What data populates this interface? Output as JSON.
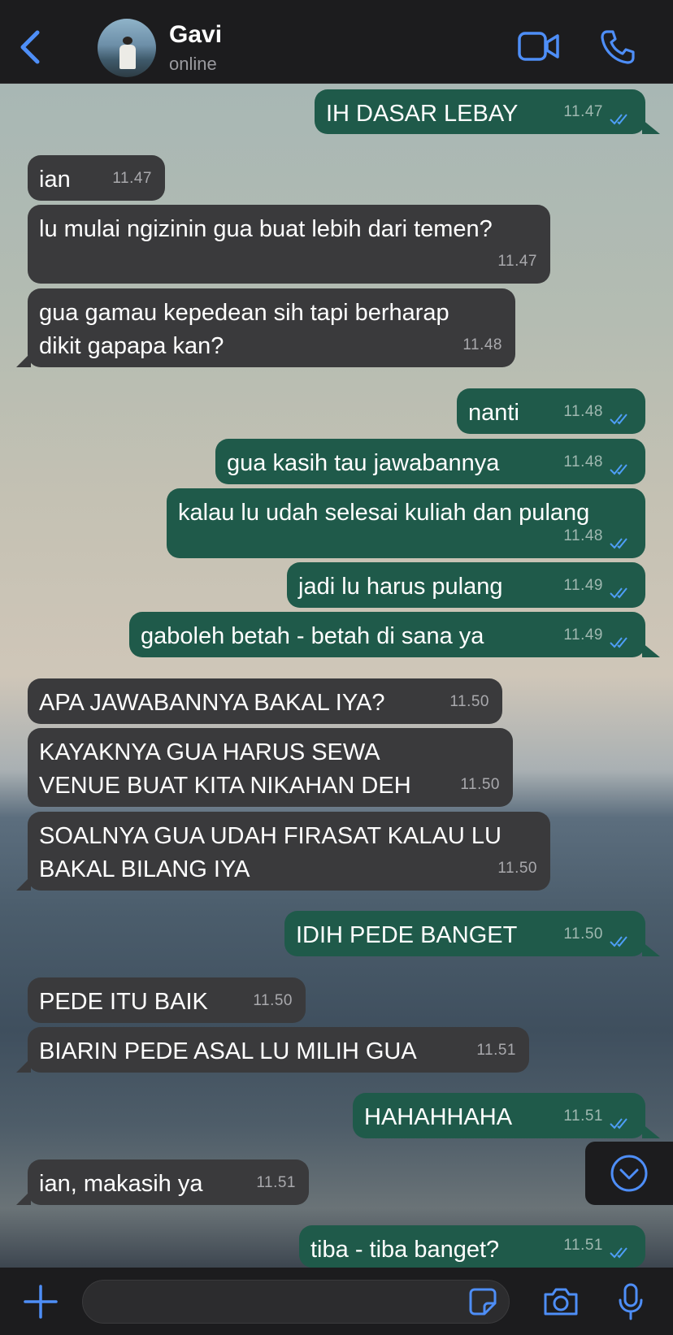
{
  "contact": {
    "name": "Gavi",
    "status": "online"
  },
  "colors": {
    "accent": "#4e8ef7",
    "incoming_bubble": "#3a3a3c",
    "outgoing_bubble": "#1f5a4a"
  },
  "messages": [
    {
      "text": "IH DASAR LEBAY",
      "time": "11.47",
      "dir": "out",
      "read": true
    },
    {
      "text": "ian",
      "time": "11.47",
      "dir": "in"
    },
    {
      "text": "lu mulai ngizinin gua buat lebih dari temen?",
      "time": "11.47",
      "dir": "in"
    },
    {
      "text": "gua gamau kepedean sih tapi berharap dikit gapapa kan?",
      "time": "11.48",
      "dir": "in"
    },
    {
      "text": "nanti",
      "time": "11.48",
      "dir": "out",
      "read": true
    },
    {
      "text": "gua kasih tau jawabannya",
      "time": "11.48",
      "dir": "out",
      "read": true
    },
    {
      "text": "kalau lu udah selesai kuliah dan pulang",
      "time": "11.48",
      "dir": "out",
      "read": true
    },
    {
      "text": "jadi lu harus pulang",
      "time": "11.49",
      "dir": "out",
      "read": true
    },
    {
      "text": "gaboleh betah - betah di sana ya",
      "time": "11.49",
      "dir": "out",
      "read": true
    },
    {
      "text": "APA JAWABANNYA BAKAL IYA?",
      "time": "11.50",
      "dir": "in"
    },
    {
      "text": "KAYAKNYA GUA HARUS SEWA VENUE BUAT KITA NIKAHAN DEH",
      "time": "11.50",
      "dir": "in"
    },
    {
      "text": "SOALNYA GUA UDAH FIRASAT KALAU LU BAKAL BILANG IYA",
      "time": "11.50",
      "dir": "in"
    },
    {
      "text": "IDIH PEDE BANGET",
      "time": "11.50",
      "dir": "out",
      "read": true
    },
    {
      "text": "PEDE ITU BAIK",
      "time": "11.50",
      "dir": "in"
    },
    {
      "text": "BIARIN PEDE ASAL LU MILIH GUA",
      "time": "11.51",
      "dir": "in"
    },
    {
      "text": "HAHAHHAHA",
      "time": "11.51",
      "dir": "out",
      "read": true
    },
    {
      "text": "ian, makasih ya",
      "time": "11.51",
      "dir": "in"
    },
    {
      "text": "tiba - tiba banget?",
      "time": "11.51",
      "dir": "out",
      "read": true
    }
  ],
  "icons": {
    "back": "chevron-left-icon",
    "video": "video-camera-icon",
    "call": "phone-icon",
    "attach": "plus-icon",
    "sticker": "sticker-icon",
    "camera": "camera-icon",
    "mic": "microphone-icon",
    "scroll": "chevron-down-circle-icon"
  },
  "composer": {
    "value": "",
    "placeholder": ""
  }
}
